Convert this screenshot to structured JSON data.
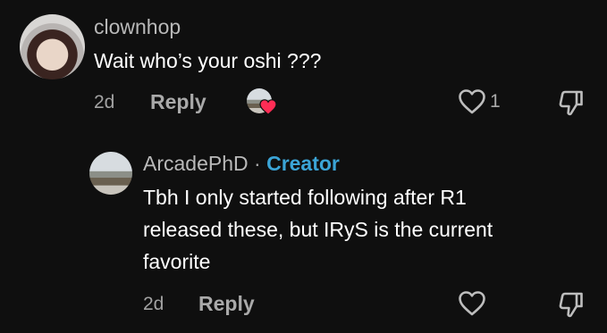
{
  "comments": [
    {
      "username": "clownhop",
      "text": "Wait who’s your oshi ???",
      "time": "2d",
      "reply_label": "Reply",
      "like_count": "1"
    }
  ],
  "reply": {
    "username": "ArcadePhD",
    "separator": "·",
    "badge": "Creator",
    "text_lines": [
      "Tbh I only started following after R1",
      "released these, but IRyS is the current",
      "favorite"
    ],
    "time": "2d",
    "reply_label": "Reply"
  },
  "colors": {
    "background": "#0f0f0f",
    "creator_badge": "#3ba4d6",
    "heart_reaction": "#ff2d55"
  },
  "icons": {
    "like": "heart-outline-icon",
    "dislike": "thumbs-down-icon",
    "creator_liked": "creator-heart-reaction-icon"
  }
}
